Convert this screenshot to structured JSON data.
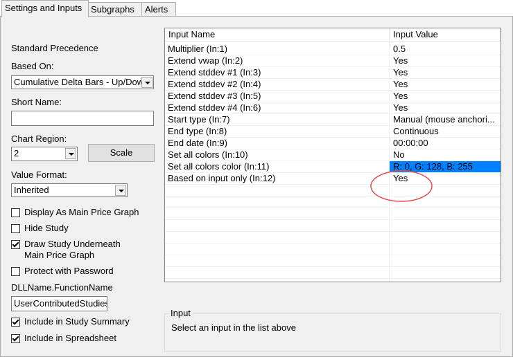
{
  "tabs": [
    "Settings and Inputs",
    "Subgraphs",
    "Alerts"
  ],
  "left": {
    "standard_precedence": "Standard Precedence",
    "based_on_label": "Based On:",
    "based_on_value": "Cumulative Delta Bars - Up/Down",
    "short_name_label": "Short Name:",
    "short_name_value": "",
    "chart_region_label": "Chart Region:",
    "chart_region_value": "2",
    "scale_button": "Scale",
    "value_format_label": "Value Format:",
    "value_format_value": "Inherited",
    "checkboxes": [
      {
        "label": "Display As Main Price Graph",
        "checked": false
      },
      {
        "label": "Hide Study",
        "checked": false
      },
      {
        "label": "Draw Study Underneath Main Price Graph",
        "checked": true
      },
      {
        "label": "Protect with Password",
        "checked": false
      }
    ],
    "dll_label": "DLLName.FunctionName",
    "dll_value": "UserContributedStudies",
    "checkboxes2": [
      {
        "label": "Include in Study Summary",
        "checked": true
      },
      {
        "label": "Include in Spreadsheet",
        "checked": true
      }
    ]
  },
  "inputs": {
    "col_name": "Input Name",
    "col_value": "Input Value",
    "rows": [
      {
        "name": "Multiplier  (In:1)",
        "value": "0.5"
      },
      {
        "name": "Extend vwap  (In:2)",
        "value": "Yes"
      },
      {
        "name": "Extend stddev #1  (In:3)",
        "value": "Yes"
      },
      {
        "name": "Extend stddev #2  (In:4)",
        "value": "Yes"
      },
      {
        "name": "Extend stddev #3  (In:5)",
        "value": "Yes"
      },
      {
        "name": "Extend stddev #4  (In:6)",
        "value": "Yes"
      },
      {
        "name": "Start type  (In:7)",
        "value": "Manual (mouse anchori..."
      },
      {
        "name": "End type  (In:8)",
        "value": "Continuous"
      },
      {
        "name": "End date  (In:9)",
        "value": "00:00:00"
      },
      {
        "name": "Set all colors  (In:10)",
        "value": "No"
      },
      {
        "name": "Set all colors color  (In:11)",
        "value": "R: 0, G: 128, B: 255"
      },
      {
        "name": "Based on input only  (In:12)",
        "value": "Yes"
      }
    ],
    "color_swatch": "#0080ff",
    "annotation_color": "#e05050"
  },
  "input_group": {
    "title": "Input",
    "text": "Select an input in the list above"
  }
}
